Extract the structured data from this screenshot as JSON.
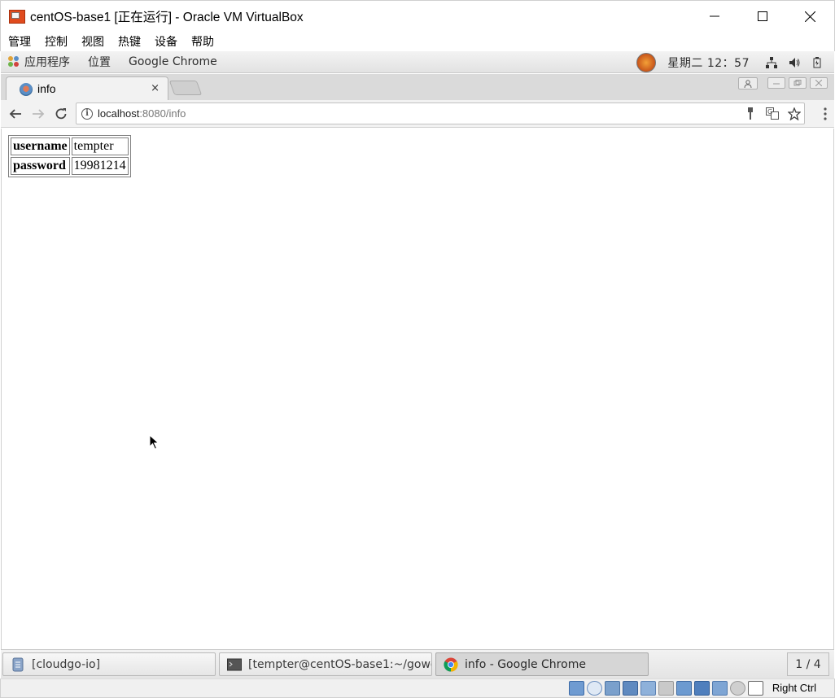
{
  "window": {
    "title": "centOS-base1 [正在运行] - Oracle VM VirtualBox"
  },
  "vbox_menu": {
    "items": [
      "管理",
      "控制",
      "视图",
      "热键",
      "设备",
      "帮助"
    ]
  },
  "gnome_panel": {
    "applications": "应用程序",
    "places": "位置",
    "active_app": "Google Chrome",
    "clock": "星期二 12：57"
  },
  "browser": {
    "tab_title": "info",
    "tab_close": "×",
    "url_host": "localhost",
    "url_rest": ":8080/info"
  },
  "page": {
    "rows": [
      {
        "key": "username",
        "value": "tempter"
      },
      {
        "key": "password",
        "value": "19981214"
      }
    ]
  },
  "taskbar": {
    "tasks": [
      {
        "label": "[cloudgo-io]"
      },
      {
        "label": "[tempter@centOS-base1:~/gowork⋯"
      },
      {
        "label": "info - Google Chrome"
      }
    ],
    "workspace": "1 / 4"
  },
  "vbox_status": {
    "host_key": "Right Ctrl"
  },
  "colors": {
    "vbox_logo": "#e04b1e",
    "panel_bg": "#e8e8e8",
    "tabstrip_bg": "#dadada",
    "task_active_bg": "#d6d6d6"
  }
}
